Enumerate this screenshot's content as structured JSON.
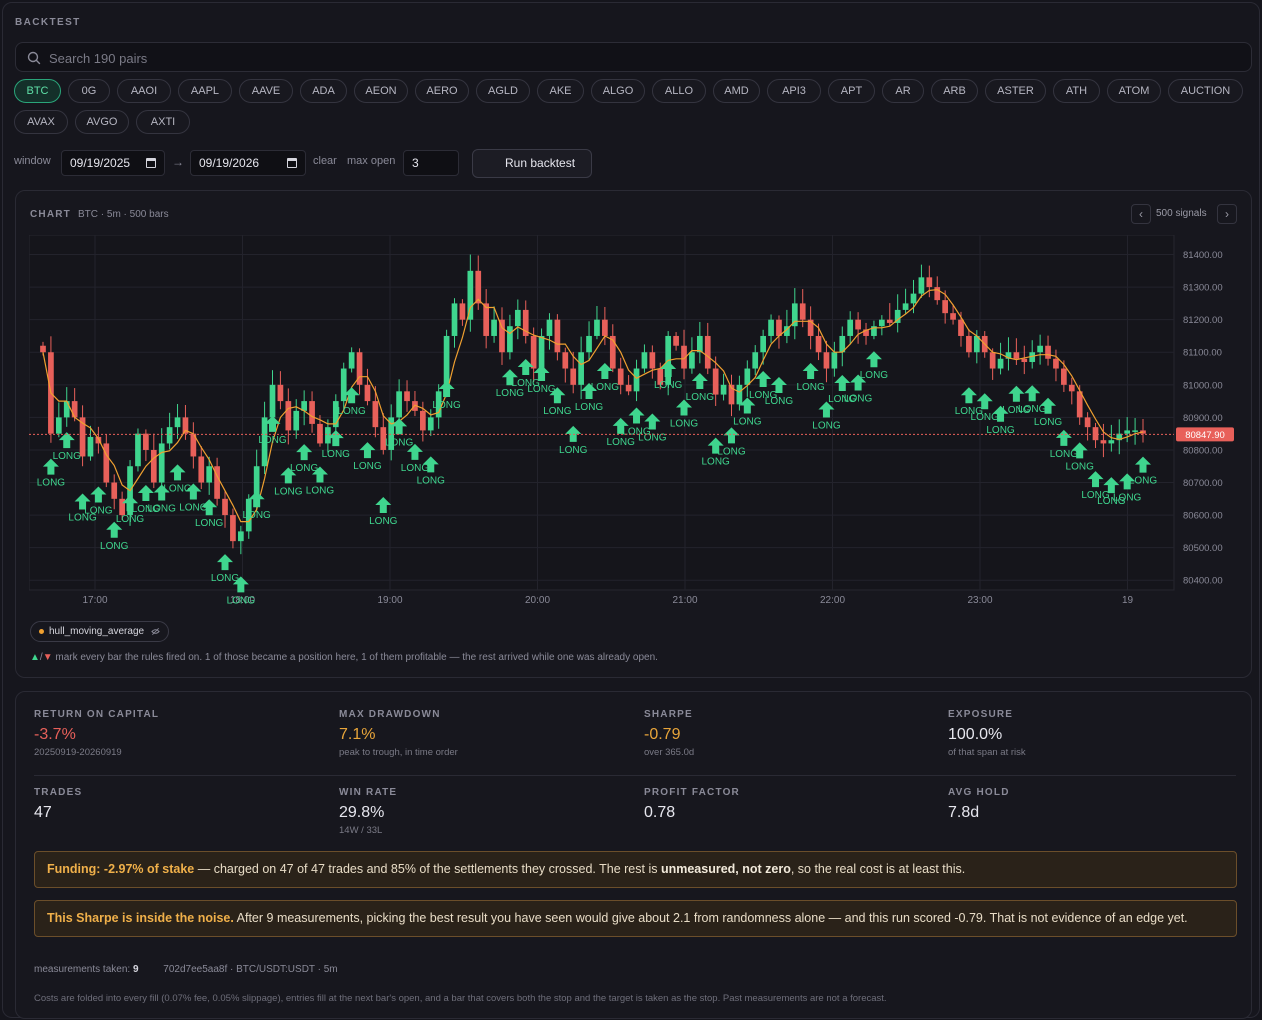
{
  "app": {
    "title": "BACKTEST"
  },
  "search": {
    "placeholder": "Search 190 pairs",
    "icon": "search-icon"
  },
  "pairs": [
    "BTC",
    "0G",
    "AAOI",
    "AAPL",
    "AAVE",
    "ADA",
    "AEON",
    "AERO",
    "AGLD",
    "AKE",
    "ALGO",
    "ALLO",
    "AMD",
    "API3",
    "APT",
    "AR",
    "ARB",
    "ASTER",
    "ATH",
    "ATOM",
    "AUCTION",
    "AVAX",
    "AVGO",
    "AXTI"
  ],
  "selected_pair": "BTC",
  "controls": {
    "window_label": "window",
    "start_date": "09/19/2025",
    "arrow": "→",
    "end_date": "09/19/2026",
    "clear_label": "clear",
    "max_open_label": "max open",
    "max_open_value": "3",
    "run_label": "Run backtest"
  },
  "chart": {
    "label": "CHART",
    "subtitle": "BTC · 5m · 500 bars",
    "signals_label": "500 signals",
    "prev_icon": "chevron-left-icon",
    "next_icon": "chevron-right-icon",
    "indicator": "hull_moving_average",
    "note_up": "▲",
    "note_sep": "/",
    "note_down": "▼",
    "note_text": " mark every bar the rules fired on. 1 of those became a position here, 1 of them profitable — the rest arrived while one was already open."
  },
  "chart_data": {
    "type": "candlestick",
    "symbol": "BTC",
    "interval": "5m",
    "x_ticks": [
      "17:00",
      "18:00",
      "19:00",
      "20:00",
      "21:00",
      "22:00",
      "23:00",
      "19"
    ],
    "y_ticks": [
      "81400.00",
      "81300.00",
      "81200.00",
      "81100.00",
      "81000.00",
      "80900.00",
      "80800.00",
      "80700.00",
      "80600.00",
      "80500.00",
      "80400.00"
    ],
    "ylim": [
      80370,
      81460
    ],
    "last_price": "80847.90",
    "signal_label": "LONG",
    "colors": {
      "up": "#3fd58e",
      "down": "#e8605a",
      "hma": "#f0a030",
      "grid": "#23232c",
      "price_line": "#e8605a"
    },
    "closes": [
      81100,
      80850,
      80900,
      80950,
      80900,
      80780,
      80840,
      80820,
      80700,
      80650,
      80600,
      80750,
      80850,
      80800,
      80700,
      80820,
      80870,
      80900,
      80850,
      80780,
      80700,
      80750,
      80650,
      80600,
      80520,
      80550,
      80650,
      80750,
      80900,
      81000,
      80950,
      80860,
      80920,
      80950,
      80880,
      80820,
      80870,
      80950,
      81050,
      81100,
      81000,
      80950,
      80870,
      80800,
      80900,
      80980,
      80950,
      80920,
      80860,
      80900,
      80980,
      81150,
      81250,
      81200,
      81350,
      81250,
      81150,
      81200,
      81100,
      81180,
      81230,
      81150,
      81050,
      81150,
      81200,
      81100,
      81050,
      81000,
      81100,
      81150,
      81200,
      81150,
      81050,
      81000,
      80980,
      81050,
      81100,
      81050,
      81000,
      81150,
      81120,
      81050,
      81100,
      81150,
      81050,
      80970,
      81000,
      80940,
      81000,
      81050,
      81100,
      81150,
      81200,
      81150,
      81180,
      81250,
      81200,
      81150,
      81100,
      81050,
      81100,
      81150,
      81200,
      81170,
      81150,
      81180,
      81200,
      81190,
      81230,
      81250,
      81280,
      81330,
      81300,
      81260,
      81220,
      81200,
      81150,
      81100,
      81150,
      81100,
      81050,
      81080,
      81100,
      81080,
      81070,
      81100,
      81120,
      81080,
      81050,
      81000,
      80980,
      80900,
      80870,
      80830,
      80820,
      80830,
      80850,
      80860,
      80860,
      80850
    ]
  },
  "stats": [
    {
      "label": "RETURN ON CAPITAL",
      "value": "-3.7%",
      "sub": "20250919-20260919",
      "tone": "neg"
    },
    {
      "label": "MAX DRAWDOWN",
      "value": "7.1%",
      "sub": "peak to trough, in time order",
      "tone": "warn"
    },
    {
      "label": "SHARPE",
      "value": "-0.79",
      "sub": "over 365.0d",
      "tone": "warn"
    },
    {
      "label": "EXPOSURE",
      "value": "100.0%",
      "sub": "of that span at risk",
      "tone": ""
    },
    {
      "label": "TRADES",
      "value": "47",
      "sub": "",
      "tone": ""
    },
    {
      "label": "WIN RATE",
      "value": "29.8%",
      "sub": "14W / 33L",
      "tone": ""
    },
    {
      "label": "PROFIT FACTOR",
      "value": "0.78",
      "sub": "",
      "tone": ""
    },
    {
      "label": "AVG HOLD",
      "value": "7.8d",
      "sub": "",
      "tone": ""
    }
  ],
  "banners": {
    "funding_bold": "Funding: -2.97% of stake",
    "funding_text1": " — charged on 47 of 47 trades and 85% of the settlements they crossed. The rest is ",
    "funding_strong": "unmeasured, not zero",
    "funding_text2": ", so the real cost is at least this.",
    "sharpe_bold": "This Sharpe is inside the noise.",
    "sharpe_text": " After 9 measurements, picking the best result you have seen would give about 2.1 from randomness alone — and this run scored -0.79. That is not evidence of an edge yet."
  },
  "footer": {
    "measurements_label": "measurements taken:",
    "measurements_value": "9",
    "run_id": "702d7ee5aa8f · BTC/USDT:USDT · 5m",
    "disclaimer": "Costs are folded into every fill (0.07% fee, 0.05% slippage), entries fill at the next bar's open, and a bar that covers both the stop and the target is taken as the stop. Past measurements are not a forecast."
  }
}
